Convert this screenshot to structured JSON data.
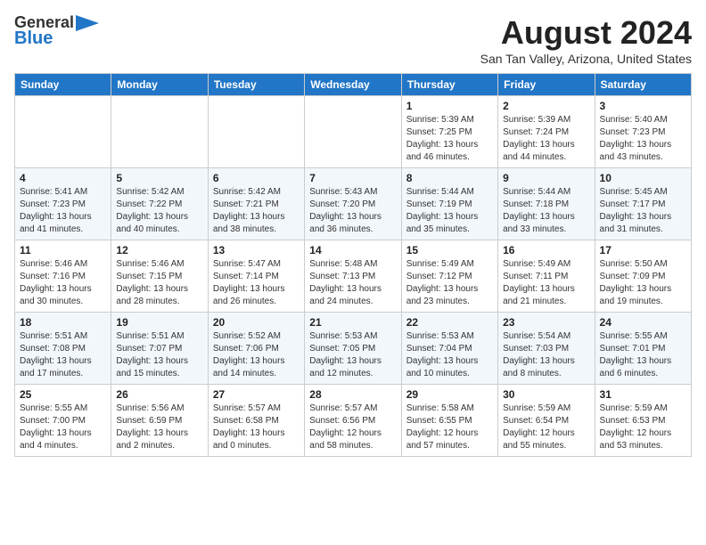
{
  "header": {
    "logo_line1": "General",
    "logo_line2": "Blue",
    "month_title": "August 2024",
    "location": "San Tan Valley, Arizona, United States"
  },
  "weekdays": [
    "Sunday",
    "Monday",
    "Tuesday",
    "Wednesday",
    "Thursday",
    "Friday",
    "Saturday"
  ],
  "weeks": [
    [
      {
        "day": "",
        "info": ""
      },
      {
        "day": "",
        "info": ""
      },
      {
        "day": "",
        "info": ""
      },
      {
        "day": "",
        "info": ""
      },
      {
        "day": "1",
        "info": "Sunrise: 5:39 AM\nSunset: 7:25 PM\nDaylight: 13 hours\nand 46 minutes."
      },
      {
        "day": "2",
        "info": "Sunrise: 5:39 AM\nSunset: 7:24 PM\nDaylight: 13 hours\nand 44 minutes."
      },
      {
        "day": "3",
        "info": "Sunrise: 5:40 AM\nSunset: 7:23 PM\nDaylight: 13 hours\nand 43 minutes."
      }
    ],
    [
      {
        "day": "4",
        "info": "Sunrise: 5:41 AM\nSunset: 7:23 PM\nDaylight: 13 hours\nand 41 minutes."
      },
      {
        "day": "5",
        "info": "Sunrise: 5:42 AM\nSunset: 7:22 PM\nDaylight: 13 hours\nand 40 minutes."
      },
      {
        "day": "6",
        "info": "Sunrise: 5:42 AM\nSunset: 7:21 PM\nDaylight: 13 hours\nand 38 minutes."
      },
      {
        "day": "7",
        "info": "Sunrise: 5:43 AM\nSunset: 7:20 PM\nDaylight: 13 hours\nand 36 minutes."
      },
      {
        "day": "8",
        "info": "Sunrise: 5:44 AM\nSunset: 7:19 PM\nDaylight: 13 hours\nand 35 minutes."
      },
      {
        "day": "9",
        "info": "Sunrise: 5:44 AM\nSunset: 7:18 PM\nDaylight: 13 hours\nand 33 minutes."
      },
      {
        "day": "10",
        "info": "Sunrise: 5:45 AM\nSunset: 7:17 PM\nDaylight: 13 hours\nand 31 minutes."
      }
    ],
    [
      {
        "day": "11",
        "info": "Sunrise: 5:46 AM\nSunset: 7:16 PM\nDaylight: 13 hours\nand 30 minutes."
      },
      {
        "day": "12",
        "info": "Sunrise: 5:46 AM\nSunset: 7:15 PM\nDaylight: 13 hours\nand 28 minutes."
      },
      {
        "day": "13",
        "info": "Sunrise: 5:47 AM\nSunset: 7:14 PM\nDaylight: 13 hours\nand 26 minutes."
      },
      {
        "day": "14",
        "info": "Sunrise: 5:48 AM\nSunset: 7:13 PM\nDaylight: 13 hours\nand 24 minutes."
      },
      {
        "day": "15",
        "info": "Sunrise: 5:49 AM\nSunset: 7:12 PM\nDaylight: 13 hours\nand 23 minutes."
      },
      {
        "day": "16",
        "info": "Sunrise: 5:49 AM\nSunset: 7:11 PM\nDaylight: 13 hours\nand 21 minutes."
      },
      {
        "day": "17",
        "info": "Sunrise: 5:50 AM\nSunset: 7:09 PM\nDaylight: 13 hours\nand 19 minutes."
      }
    ],
    [
      {
        "day": "18",
        "info": "Sunrise: 5:51 AM\nSunset: 7:08 PM\nDaylight: 13 hours\nand 17 minutes."
      },
      {
        "day": "19",
        "info": "Sunrise: 5:51 AM\nSunset: 7:07 PM\nDaylight: 13 hours\nand 15 minutes."
      },
      {
        "day": "20",
        "info": "Sunrise: 5:52 AM\nSunset: 7:06 PM\nDaylight: 13 hours\nand 14 minutes."
      },
      {
        "day": "21",
        "info": "Sunrise: 5:53 AM\nSunset: 7:05 PM\nDaylight: 13 hours\nand 12 minutes."
      },
      {
        "day": "22",
        "info": "Sunrise: 5:53 AM\nSunset: 7:04 PM\nDaylight: 13 hours\nand 10 minutes."
      },
      {
        "day": "23",
        "info": "Sunrise: 5:54 AM\nSunset: 7:03 PM\nDaylight: 13 hours\nand 8 minutes."
      },
      {
        "day": "24",
        "info": "Sunrise: 5:55 AM\nSunset: 7:01 PM\nDaylight: 13 hours\nand 6 minutes."
      }
    ],
    [
      {
        "day": "25",
        "info": "Sunrise: 5:55 AM\nSunset: 7:00 PM\nDaylight: 13 hours\nand 4 minutes."
      },
      {
        "day": "26",
        "info": "Sunrise: 5:56 AM\nSunset: 6:59 PM\nDaylight: 13 hours\nand 2 minutes."
      },
      {
        "day": "27",
        "info": "Sunrise: 5:57 AM\nSunset: 6:58 PM\nDaylight: 13 hours\nand 0 minutes."
      },
      {
        "day": "28",
        "info": "Sunrise: 5:57 AM\nSunset: 6:56 PM\nDaylight: 12 hours\nand 58 minutes."
      },
      {
        "day": "29",
        "info": "Sunrise: 5:58 AM\nSunset: 6:55 PM\nDaylight: 12 hours\nand 57 minutes."
      },
      {
        "day": "30",
        "info": "Sunrise: 5:59 AM\nSunset: 6:54 PM\nDaylight: 12 hours\nand 55 minutes."
      },
      {
        "day": "31",
        "info": "Sunrise: 5:59 AM\nSunset: 6:53 PM\nDaylight: 12 hours\nand 53 minutes."
      }
    ]
  ]
}
